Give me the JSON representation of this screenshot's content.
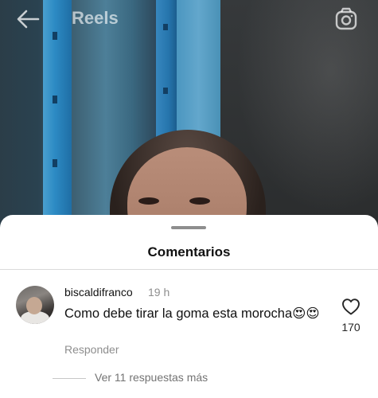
{
  "header": {
    "title": "Reels",
    "back_icon": "arrow-left-icon",
    "camera_icon": "camera-icon"
  },
  "sheet": {
    "title": "Comentarios"
  },
  "comment": {
    "username": "biscaldifranco",
    "time": "19 h",
    "text": "Como debe tirar la goma esta morocha😍😍",
    "reply_label": "Responder",
    "like_icon": "heart-outline-icon",
    "like_count": "170",
    "view_replies": "Ver 11 respuestas más"
  },
  "colors": {
    "sheet_bg": "#ffffff",
    "secondary_text": "#8e8e8e",
    "primary_text": "#111111"
  }
}
